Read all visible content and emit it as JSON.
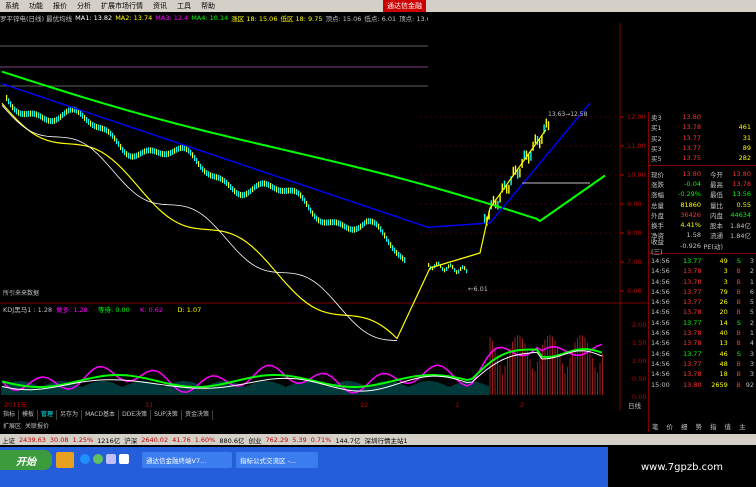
{
  "menu": [
    "系统",
    "功能",
    "报价",
    "分析",
    "扩展市场行情",
    "资讯",
    "工具",
    "帮助"
  ],
  "brand": "通达信金融",
  "legend": [
    {
      "text": "罗平锌电(日线) 最优均线",
      "color": "#c0c0c0"
    },
    {
      "text": "MA1: 13.82",
      "color": "#ffffff"
    },
    {
      "text": "MA2: 13.74",
      "color": "#ffff00"
    },
    {
      "text": "MA3: 12.4",
      "color": "#ff00ff"
    },
    {
      "text": "MA4: 10.14",
      "color": "#00ff00"
    },
    {
      "text": "涨区 18: 15.06",
      "color": "#ffff00"
    },
    {
      "text": "低区 18: 9.75",
      "color": "#ffff00"
    },
    {
      "text": "顶点: 15.06",
      "color": "#c0c0c0"
    },
    {
      "text": "低点: 6.01",
      "color": "#c0c0c0"
    },
    {
      "text": "顶点: 13.60",
      "color": "#c0c0c0"
    }
  ],
  "chart_labels": {
    "low_marker": "←6.01",
    "high_marker": "13.63→12.58",
    "no_data_note": "所引来来数据",
    "kdj_title": "KDJ黑马1 : 1.28",
    "kdj_items": [
      {
        "text": "做多: 1.28",
        "color": "#ff00ff"
      },
      {
        "text": "等待: 0.00",
        "color": "#00ff00"
      },
      {
        "text": "K: 0.62",
        "color": "#ff00ff"
      },
      {
        "text": "D: 1.07",
        "color": "#ffff00"
      }
    ],
    "x_axis": [
      "2011年",
      "11",
      "12",
      "1",
      "2"
    ],
    "y_axis_main": [
      "12.00",
      "11.00",
      "10.00",
      "9.00",
      "8.00",
      "7.00",
      "6.00"
    ],
    "y_axis_kdj": [
      "2.00",
      "1.50",
      "1.00",
      "0.50",
      "0.00"
    ]
  },
  "tabs": [
    "指标",
    "模板",
    "管理",
    "另存为",
    "MACD基本",
    "DDE决策",
    "SUP决策",
    "资金决策"
  ],
  "active_tab": "管理",
  "sub_tabs": [
    "扩展区",
    "关联报价"
  ],
  "right_label": "日线",
  "quote": {
    "rows": [
      {
        "l": "卖3",
        "v": "13.80",
        "n": "",
        "c": "#ff3030"
      },
      {
        "l": "买1",
        "v": "13.78",
        "n": "461",
        "c": "#ff3030"
      },
      {
        "l": "买2",
        "v": "13.77",
        "n": "31",
        "c": "#ff3030"
      },
      {
        "l": "买3",
        "v": "13.77",
        "n": "89",
        "c": "#ff3030"
      },
      {
        "l": "买5",
        "v": "13.75",
        "n": "282",
        "c": "#ff3030"
      }
    ],
    "stats": [
      {
        "l": "现价",
        "v": "13.80",
        "l2": "今开",
        "v2": "13.80",
        "c": "#ff3030",
        "c2": "#ff3030"
      },
      {
        "l": "涨跌",
        "v": "-0.04",
        "l2": "最高",
        "v2": "13.78",
        "c": "#00ff00",
        "c2": "#ff3030"
      },
      {
        "l": "涨幅",
        "v": "-0.29%",
        "l2": "最低",
        "v2": "13.56",
        "c": "#00ff00",
        "c2": "#00ff00"
      },
      {
        "l": "总量",
        "v": "81860",
        "l2": "量比",
        "v2": "0.55",
        "c": "#ffff00",
        "c2": "#ffff00"
      },
      {
        "l": "外盘",
        "v": "36426",
        "l2": "内盘",
        "v2": "44634",
        "c": "#ff3030",
        "c2": "#00ff00"
      },
      {
        "l": "换手",
        "v": "4.41%",
        "l2": "股本",
        "v2": "1.84亿",
        "c": "#ffff00",
        "c2": "#c0c0c0"
      },
      {
        "l": "净资",
        "v": "1.58",
        "l2": "流通",
        "v2": "1.84亿",
        "c": "#c0c0c0",
        "c2": "#c0c0c0"
      },
      {
        "l": "收益(三)",
        "v": "-0.926",
        "l2": "PE(动)",
        "v2": "",
        "c": "#c0c0c0",
        "c2": "#c0c0c0"
      }
    ],
    "trades": [
      {
        "t": "14:56",
        "p": "13.77",
        "q": "49",
        "s": "S",
        "n": "3",
        "pc": "#00ff00",
        "sc": "#00ff00"
      },
      {
        "t": "14:56",
        "p": "13.78",
        "q": "3",
        "s": "B",
        "n": "2",
        "pc": "#ff3030",
        "sc": "#ff3030"
      },
      {
        "t": "14:56",
        "p": "13.78",
        "q": "3",
        "s": "B",
        "n": "1",
        "pc": "#ff3030",
        "sc": "#ff3030"
      },
      {
        "t": "14:56",
        "p": "13.77",
        "q": "79",
        "s": "B",
        "n": "6",
        "pc": "#ff3030",
        "sc": "#ff3030"
      },
      {
        "t": "14:56",
        "p": "13.77",
        "q": "26",
        "s": "B",
        "n": "5",
        "pc": "#ff3030",
        "sc": "#ff3030"
      },
      {
        "t": "14:56",
        "p": "13.78",
        "q": "20",
        "s": "B",
        "n": "5",
        "pc": "#ff3030",
        "sc": "#ff3030"
      },
      {
        "t": "14:56",
        "p": "13.77",
        "q": "14",
        "s": "S",
        "n": "2",
        "pc": "#00ff00",
        "sc": "#00ff00"
      },
      {
        "t": "14:56",
        "p": "13.78",
        "q": "40",
        "s": "B",
        "n": "1",
        "pc": "#ff3030",
        "sc": "#ff3030"
      },
      {
        "t": "14:56",
        "p": "13.78",
        "q": "13",
        "s": "B",
        "n": "4",
        "pc": "#ff3030",
        "sc": "#ff3030"
      },
      {
        "t": "14:56",
        "p": "13.77",
        "q": "46",
        "s": "S",
        "n": "3",
        "pc": "#00ff00",
        "sc": "#00ff00"
      },
      {
        "t": "14:56",
        "p": "13.77",
        "q": "48",
        "s": "B",
        "n": "3",
        "pc": "#ff3030",
        "sc": "#ff3030"
      },
      {
        "t": "14:56",
        "p": "13.78",
        "q": "18",
        "s": "B",
        "n": "3",
        "pc": "#ff3030",
        "sc": "#ff3030"
      },
      {
        "t": "15:00",
        "p": "13.80",
        "q": "2659",
        "s": "B",
        "n": "92",
        "pc": "#ff3030",
        "sc": "#ff3030"
      }
    ],
    "bottom_tabs": [
      "笔",
      "价",
      "细",
      "势",
      "指",
      "值",
      "主"
    ]
  },
  "ticker": [
    {
      "text": "上证",
      "c": "#000"
    },
    {
      "text": "2439.63",
      "c": "#c00000"
    },
    {
      "text": "30.08",
      "c": "#c00000"
    },
    {
      "text": "1.25%",
      "c": "#c00000"
    },
    {
      "text": "1216亿",
      "c": "#000"
    },
    {
      "text": "沪深",
      "c": "#000"
    },
    {
      "text": "2640.02",
      "c": "#c00000"
    },
    {
      "text": "41.76",
      "c": "#c00000"
    },
    {
      "text": "1.60%",
      "c": "#c00000"
    },
    {
      "text": "880.6亿",
      "c": "#000"
    },
    {
      "text": "创业",
      "c": "#000"
    },
    {
      "text": "762.29",
      "c": "#c00000"
    },
    {
      "text": "5.39",
      "c": "#c00000"
    },
    {
      "text": "0.71%",
      "c": "#c00000"
    },
    {
      "text": "144.7亿",
      "c": "#000"
    },
    {
      "text": "深圳行情主站1",
      "c": "#000"
    }
  ],
  "taskbar": {
    "start": "开始",
    "items": [
      "通达信金融终端V7...",
      "指标公式交流区 -..."
    ]
  },
  "watermark": "www.7gpzb.com"
}
